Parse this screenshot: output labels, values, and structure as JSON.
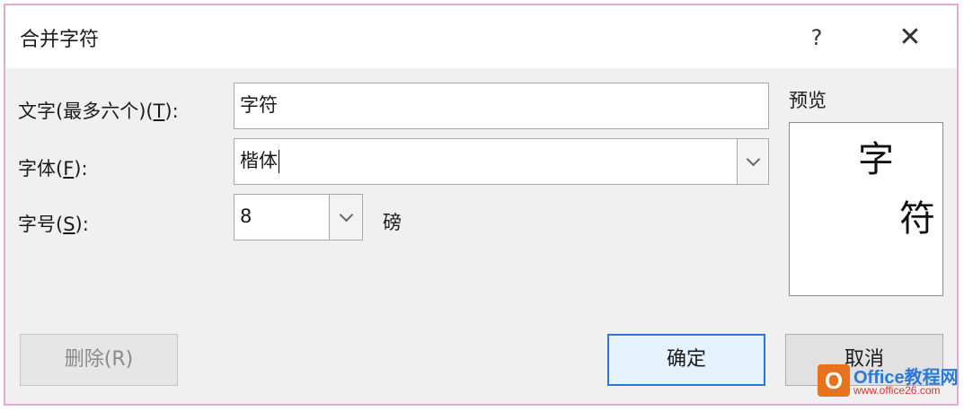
{
  "dialog": {
    "title": "合并字符",
    "help_label": "?",
    "close_label": "✕"
  },
  "form": {
    "text_label": "文字(最多六个)(",
    "text_hotkey": "T",
    "text_label_tail": "):",
    "text_value": "字符",
    "font_label": "字体(",
    "font_hotkey": "F",
    "font_label_tail": "):",
    "font_value": "楷体",
    "size_label": "字号(",
    "size_hotkey": "S",
    "size_label_tail": "):",
    "size_value": "8",
    "size_unit": "磅"
  },
  "preview": {
    "label": "预览",
    "char1": "字",
    "char2": "符"
  },
  "buttons": {
    "delete_label": "删除(R)",
    "ok_label": "确定",
    "cancel_label": "取消"
  },
  "watermark": {
    "logo_letter": "O",
    "brand": "Office教程网",
    "url": "www.office26.com"
  },
  "colors": {
    "accent": "#2b78d4",
    "border_pink": "#e6a8d6"
  }
}
